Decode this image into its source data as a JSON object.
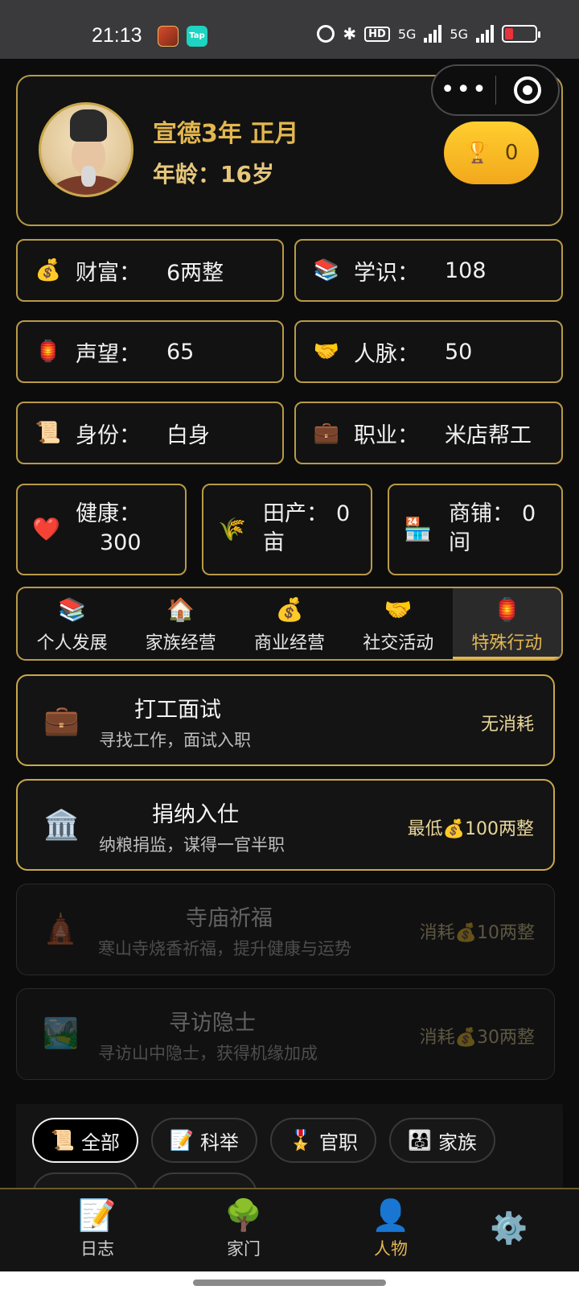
{
  "status_bar": {
    "time": "21:13",
    "app_icon_2_label": "Tap",
    "hd_label": "HD",
    "net1": "5G",
    "net2": "5G"
  },
  "header": {
    "date_title": "宣德3年 正月",
    "age": "年龄：16岁",
    "trophy_count": "0"
  },
  "stats": {
    "wealth": {
      "icon": "money-bag-icon",
      "label": "财富：",
      "value": "6两整"
    },
    "knowledge": {
      "icon": "books-icon",
      "label": "学识：",
      "value": "108"
    },
    "prestige": {
      "icon": "lantern-icon",
      "label": "声望：",
      "value": "65"
    },
    "connections": {
      "icon": "handshake-icon",
      "label": "人脉：",
      "value": "50"
    },
    "identity": {
      "icon": "scroll-icon",
      "label": "身份：",
      "value": "白身"
    },
    "occupation": {
      "icon": "briefcase-icon",
      "label": "职业：",
      "value": "米店帮工"
    },
    "health": {
      "icon": "heart-icon",
      "label": "健康：",
      "value": "300"
    },
    "farmland": {
      "icon": "rice-icon",
      "label": "田产：",
      "value": "0",
      "unit": "亩"
    },
    "shops": {
      "icon": "store-icon",
      "label": "商铺：",
      "value": "0",
      "unit": "间"
    }
  },
  "tabs": [
    {
      "icon": "books-icon",
      "label": "个人发展"
    },
    {
      "icon": "house-icon",
      "label": "家族经营"
    },
    {
      "icon": "money-bag-icon",
      "label": "商业经营"
    },
    {
      "icon": "handshake-icon",
      "label": "社交活动"
    },
    {
      "icon": "lantern-icon",
      "label": "特殊行动"
    }
  ],
  "active_tab": "特殊行动",
  "actions": [
    {
      "icon": "briefcase-icon",
      "title": "打工面试",
      "desc": "寻找工作，面试入职",
      "cost": "无消耗",
      "enabled": true
    },
    {
      "icon": "bank-icon",
      "title": "捐纳入仕",
      "desc": "纳粮捐监，谋得一官半职",
      "cost": "最低💰100两整",
      "enabled": true
    },
    {
      "icon": "pagoda-icon",
      "title": "寺庙祈福",
      "desc": "寒山寺烧香祈福，提升健康与运势",
      "cost": "消耗💰10两整",
      "enabled": false
    },
    {
      "icon": "landscape-icon",
      "title": "寻访隐士",
      "desc": "寻访山中隐士，获得机缘加成",
      "cost": "消耗💰30两整",
      "enabled": false
    }
  ],
  "filters": [
    {
      "icon": "scroll-icon",
      "label": "全部",
      "active": true
    },
    {
      "icon": "memo-icon",
      "label": "科举",
      "active": false
    },
    {
      "icon": "medal-icon",
      "label": "官职",
      "active": false
    },
    {
      "icon": "family-icon",
      "label": "家族",
      "active": false
    }
  ],
  "bottom_nav": [
    {
      "icon": "memo-icon",
      "label": "日志"
    },
    {
      "icon": "tree-icon",
      "label": "家门"
    },
    {
      "icon": "person-icon",
      "label": "人物",
      "active": true
    },
    {
      "icon": "gear-icon",
      "label": ""
    }
  ],
  "colors": {
    "accent_gold": "#e3b750",
    "border_gold": "#b89a47",
    "trophy_yellow": "#ffce2f",
    "background": "#0c0c0d"
  }
}
